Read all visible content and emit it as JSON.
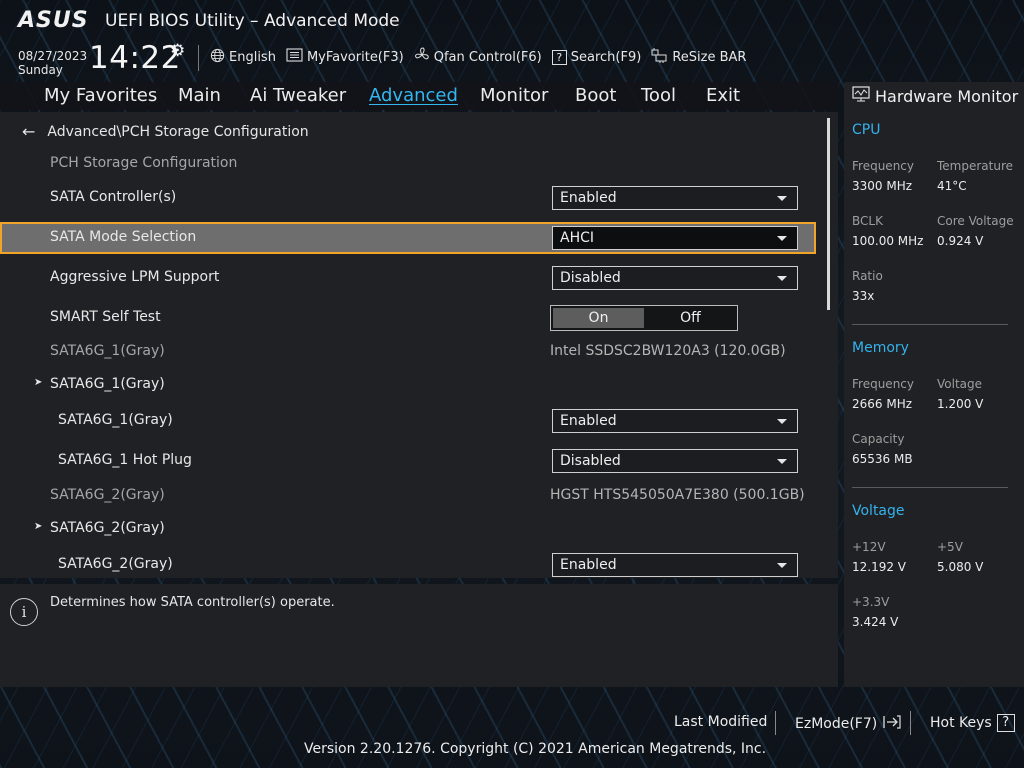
{
  "header": {
    "brand": "ASUS",
    "title": "UEFI BIOS Utility – Advanced Mode",
    "date": "08/27/2023",
    "day": "Sunday",
    "time": "14:22",
    "icons": {
      "settings": "gear-icon"
    }
  },
  "toolbar": {
    "language": "English",
    "favorite": "MyFavorite(F3)",
    "qfan": "Qfan Control(F6)",
    "search": "Search(F9)",
    "resize_bar": "ReSize BAR"
  },
  "menu": {
    "tabs": [
      "My Favorites",
      "Main",
      "Ai Tweaker",
      "Advanced",
      "Monitor",
      "Boot",
      "Tool",
      "Exit"
    ],
    "active": "Advanced"
  },
  "breadcrumb": "Advanced\\PCH Storage Configuration",
  "settings": [
    {
      "label": "PCH Storage Configuration"
    },
    {
      "label": "SATA Controller(s)",
      "value": "Enabled"
    },
    {
      "label": "SATA Mode Selection",
      "value": "AHCI"
    },
    {
      "label": "Aggressive LPM Support",
      "value": "Disabled"
    },
    {
      "label": "SMART Self Test",
      "on": "On",
      "off": "Off",
      "state": "On"
    },
    {
      "label": "SATA6G_1(Gray)",
      "value": "Intel SSDSC2BW120A3 (120.0GB)"
    },
    {
      "label": "SATA6G_1(Gray)"
    },
    {
      "label": "SATA6G_1(Gray)",
      "value": "Enabled"
    },
    {
      "label": "SATA6G_1 Hot Plug",
      "value": "Disabled"
    },
    {
      "label": "SATA6G_2(Gray)",
      "value": "HGST HTS545050A7E380 (500.1GB)"
    },
    {
      "label": "SATA6G_2(Gray)"
    },
    {
      "label": "SATA6G_2(Gray)",
      "value": "Enabled"
    }
  ],
  "help_text": "Determines how SATA controller(s) operate.",
  "hardware_monitor": {
    "title": "Hardware Monitor",
    "cpu": {
      "title": "CPU",
      "frequency_label": "Frequency",
      "frequency": "3300 MHz",
      "temperature_label": "Temperature",
      "temperature": "41°C",
      "bclk_label": "BCLK",
      "bclk": "100.00 MHz",
      "core_voltage_label": "Core Voltage",
      "core_voltage": "0.924 V",
      "ratio_label": "Ratio",
      "ratio": "33x"
    },
    "memory": {
      "title": "Memory",
      "frequency_label": "Frequency",
      "frequency": "2666 MHz",
      "voltage_label": "Voltage",
      "voltage": "1.200 V",
      "capacity_label": "Capacity",
      "capacity": "65536 MB"
    },
    "voltage": {
      "title": "Voltage",
      "v12_label": "+12V",
      "v12": "12.192 V",
      "v5_label": "+5V",
      "v5": "5.080 V",
      "v33_label": "+3.3V",
      "v33": "3.424 V"
    }
  },
  "footer": {
    "last_modified": "Last Modified",
    "ezmode": "EzMode(F7)",
    "hot_keys": "Hot Keys",
    "copyright": "Version 2.20.1276. Copyright (C) 2021 American Megatrends, Inc."
  },
  "colors": {
    "accent": "#34b6f0",
    "highlight_border": "#f0a52a",
    "panel": "#1f2124"
  }
}
